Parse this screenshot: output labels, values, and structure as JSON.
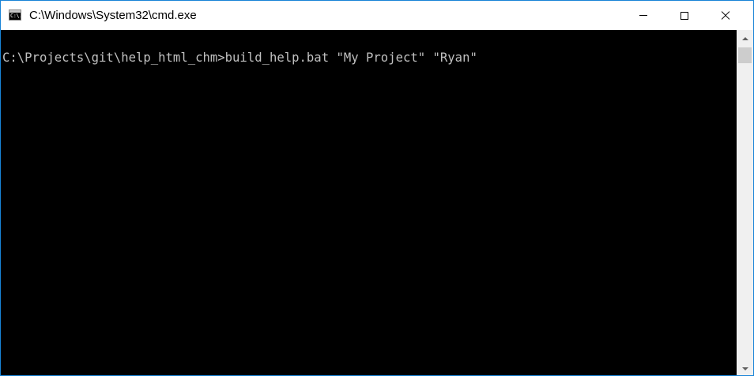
{
  "window": {
    "title": "C:\\Windows\\System32\\cmd.exe",
    "app_icon_text": "C:\\."
  },
  "console": {
    "lines": [
      "C:\\Projects\\git\\help_html_chm>build_help.bat \"My Project\" \"Ryan\""
    ],
    "foreground": "#c0c0c0",
    "background": "#000000"
  },
  "colors": {
    "window_border": "#1883d7",
    "titlebar": "#ffffff",
    "scrollbar_track": "#f0f0f0",
    "scrollbar_thumb": "#cdcdcd"
  },
  "icons": {
    "app": "cmd-app-icon",
    "minimize": "minimize-icon",
    "maximize": "maximize-icon",
    "close": "close-icon",
    "scroll_up": "chevron-up-icon",
    "scroll_down": "chevron-down-icon"
  }
}
